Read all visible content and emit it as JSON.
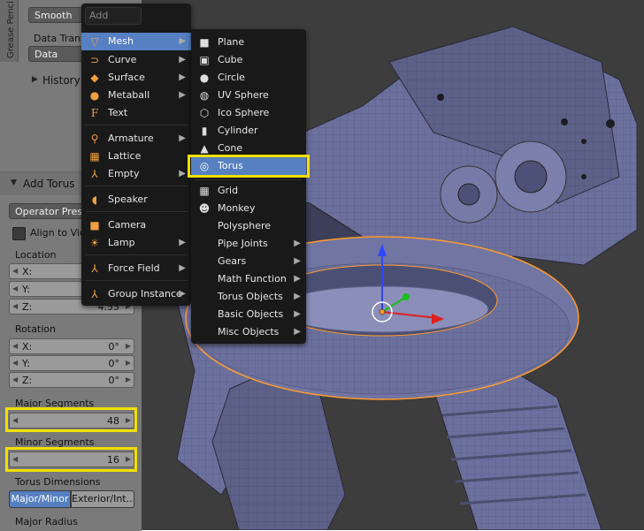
{
  "shelf": {
    "vertical_tab": "Grease Penci",
    "smooth_value": "Smooth",
    "data_transfer_label": "Data Trans",
    "data_value": "Data",
    "history": "History"
  },
  "redo_panel": {
    "title": "Add Torus",
    "operator_presets": "Operator Prese",
    "align_to_view": "Align to Vie",
    "location_label": "Location",
    "location": [
      {
        "axis": "X:",
        "value": ""
      },
      {
        "axis": "Y:",
        "value": ""
      },
      {
        "axis": "Z:",
        "value": "4.55"
      }
    ],
    "rotation_label": "Rotation",
    "rotation": [
      {
        "axis": "X:",
        "value": "0°"
      },
      {
        "axis": "Y:",
        "value": "0°"
      },
      {
        "axis": "Z:",
        "value": "0°"
      }
    ],
    "major_segments_label": "Major Segments",
    "major_segments": "48",
    "minor_segments_label": "Minor Segments",
    "minor_segments": "16",
    "torus_dimensions_label": "Torus Dimensions",
    "mode_major_minor": "Major/Minor",
    "mode_exterior_interior": "Exterior/Int...",
    "major_radius_label": "Major Radius"
  },
  "add_menu": {
    "search_placeholder": "Add",
    "items": [
      {
        "label": "Mesh",
        "icon": "mesh-icon"
      },
      {
        "label": "Curve",
        "icon": "curve-icon"
      },
      {
        "label": "Surface",
        "icon": "surface-icon"
      },
      {
        "label": "Metaball",
        "icon": "metaball-icon"
      },
      {
        "label": "Text",
        "icon": "text-icon"
      },
      {
        "label": "Armature",
        "icon": "armature-icon"
      },
      {
        "label": "Lattice",
        "icon": "lattice-icon"
      },
      {
        "label": "Empty",
        "icon": "empty-icon"
      },
      {
        "label": "Speaker",
        "icon": "speaker-icon"
      },
      {
        "label": "Camera",
        "icon": "camera-icon"
      },
      {
        "label": "Lamp",
        "icon": "lamp-icon"
      },
      {
        "label": "Force Field",
        "icon": "force-field-icon"
      },
      {
        "label": "Group Instance",
        "icon": "group-instance-icon"
      }
    ]
  },
  "mesh_menu": {
    "items": [
      {
        "label": "Plane",
        "icon": "plane-icon"
      },
      {
        "label": "Cube",
        "icon": "cube-icon"
      },
      {
        "label": "Circle",
        "icon": "circle-icon"
      },
      {
        "label": "UV Sphere",
        "icon": "uv-sphere-icon"
      },
      {
        "label": "Ico Sphere",
        "icon": "ico-sphere-icon"
      },
      {
        "label": "Cylinder",
        "icon": "cylinder-icon"
      },
      {
        "label": "Cone",
        "icon": "cone-icon"
      },
      {
        "label": "Torus",
        "icon": "torus-icon"
      },
      {
        "label": "Grid",
        "icon": "grid-icon"
      },
      {
        "label": "Monkey",
        "icon": "monkey-icon"
      },
      {
        "label": "Polysphere",
        "icon": ""
      },
      {
        "label": "Pipe Joints",
        "icon": ""
      },
      {
        "label": "Gears",
        "icon": ""
      },
      {
        "label": "Math Function",
        "icon": ""
      },
      {
        "label": "Torus Objects",
        "icon": ""
      },
      {
        "label": "Basic Objects",
        "icon": ""
      },
      {
        "label": "Misc Objects",
        "icon": ""
      }
    ]
  },
  "colors": {
    "highlight": "#f0e000",
    "menu_bg": "#191919",
    "menu_active": "#5680c2",
    "model": "#6f73a0",
    "selection_outline": "#ff9a2e"
  }
}
